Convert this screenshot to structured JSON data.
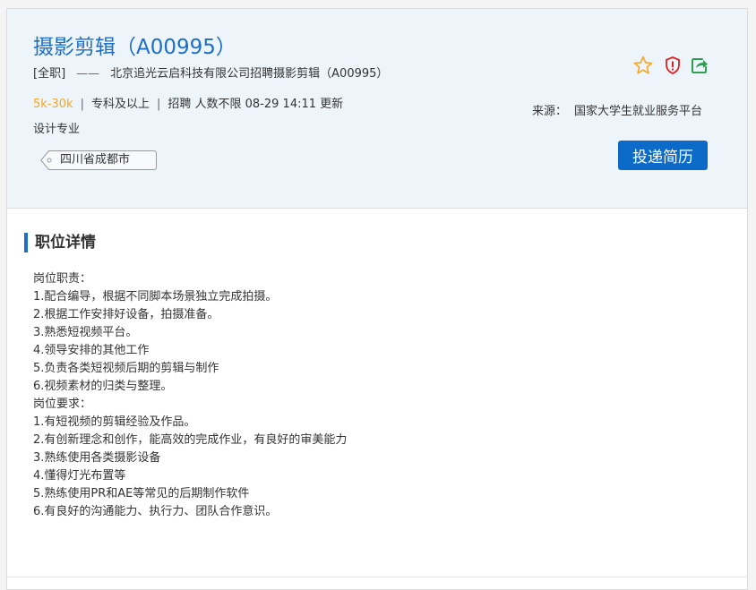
{
  "job": {
    "title": "摄影剪辑（A00995）",
    "type": "[全职]",
    "dash": "——",
    "company_line": "北京追光云启科技有限公司招聘摄影剪辑（A00995）",
    "salary": "5k-30k",
    "education": "专科及以上",
    "headcount": "招聘 人数不限",
    "updated": "08-29 14:11 更新",
    "major": "设计专业",
    "location": "四川省成都市",
    "separator": "|"
  },
  "actions": {
    "icons": [
      "star-icon",
      "shield-alert-icon",
      "share-icon"
    ],
    "apply_label": "投递简历"
  },
  "source": {
    "label": "来源：",
    "value": "国家大学生就业服务平台"
  },
  "details": {
    "title": "职位详情",
    "lines": [
      "岗位职责：",
      "1.配合编导，根据不同脚本场景独立完成拍摄。",
      "2.根据工作安排好设备，拍摄准备。",
      "3.熟悉短视频平台。",
      "4.领导安排的其他工作",
      "5.负责各类短视频后期的剪辑与制作",
      "6.视频素材的归类与整理。",
      "岗位要求：",
      "1.有短视频的剪辑经验及作品。",
      "2.有创新理念和创作，能高效的完成作业，有良好的审美能力",
      "3.熟练使用各类摄影设备",
      "4.懂得灯光布置等",
      "5.熟练使用PR和AE等常见的后期制作软件",
      "6.有良好的沟通能力、执行力、团队合作意识。"
    ]
  },
  "colors": {
    "title_blue": "#1c6ec7",
    "salary_orange": "#f5a623",
    "button_blue": "#0c6ac9",
    "header_bg": "#eef5fa"
  }
}
